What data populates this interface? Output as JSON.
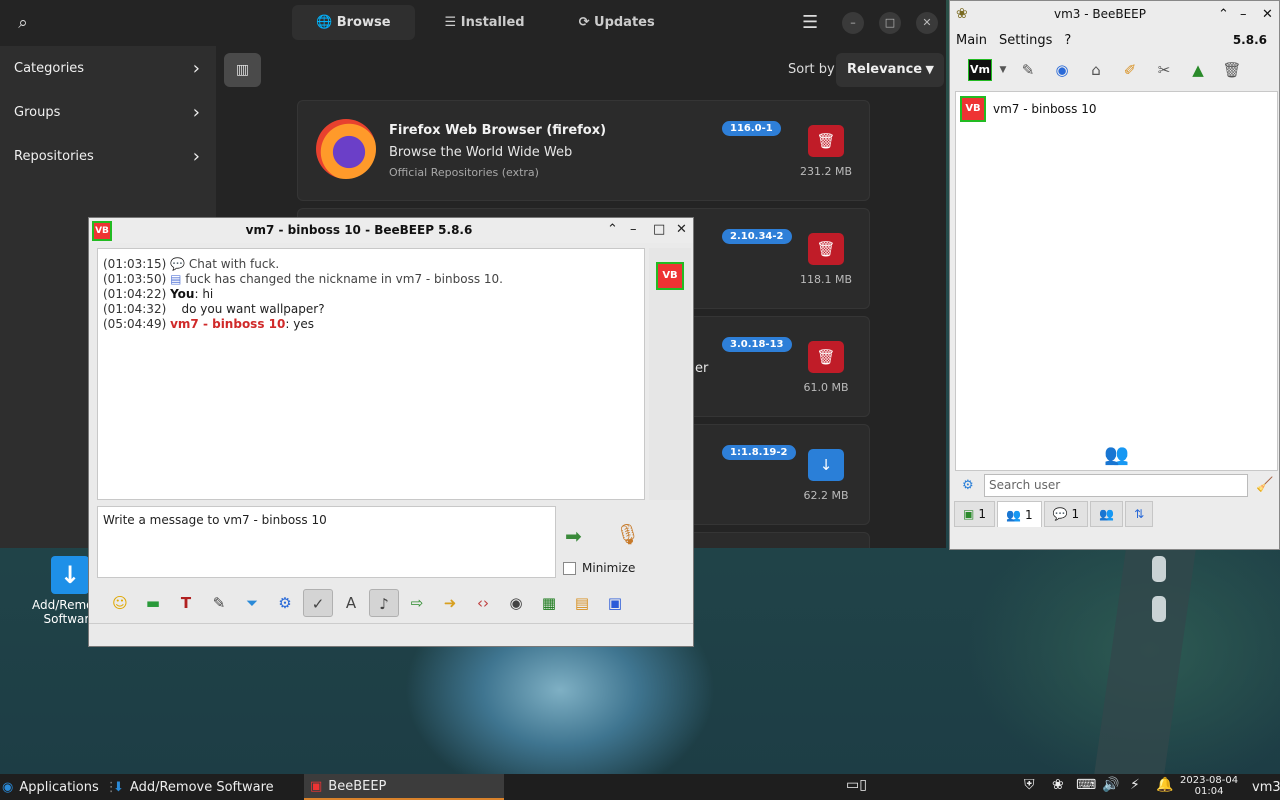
{
  "desktop": {
    "icon_label": "Add/Remove Software"
  },
  "software": {
    "tabs": [
      "Browse",
      "Installed",
      "Updates"
    ],
    "sidebar": [
      "Categories",
      "Groups",
      "Repositories"
    ],
    "sort_label": "Sort by",
    "sort_value": "Relevance",
    "packages": [
      {
        "title": "Firefox Web Browser (firefox)",
        "description": "Browse the World Wide Web",
        "repo": "Official Repositories (extra)",
        "version": "116.0-1",
        "size": "231.2 MB",
        "action": "remove"
      },
      {
        "title": "",
        "description": "",
        "repo": "",
        "version": "2.10.34-2",
        "size": "118.1 MB",
        "action": "remove"
      },
      {
        "title": "",
        "description": "er",
        "repo": "",
        "version": "3.0.18-13",
        "size": "61.0 MB",
        "action": "remove"
      },
      {
        "title": "",
        "description": "",
        "repo": "",
        "version": "1:1.8.19-2",
        "size": "62.2 MB",
        "action": "install"
      }
    ]
  },
  "chat": {
    "title": "vm7 - binboss 10 - BeeBEEP 5.8.6",
    "avatar": "VB",
    "messages": [
      {
        "time": "(01:03:15)",
        "sender": "",
        "text": "Chat with fuck.",
        "kind": "system"
      },
      {
        "time": "(01:03:50)",
        "sender": "",
        "text": "fuck has changed the nickname in vm7 - binboss 10.",
        "kind": "system"
      },
      {
        "time": "(01:04:22)",
        "sender": "You",
        "text": ": hi",
        "kind": "me"
      },
      {
        "time": "(01:04:32)",
        "sender": "",
        "text": "do you want wallpaper?",
        "kind": "cont"
      },
      {
        "time": "(05:04:49)",
        "sender": "vm7 - binboss 10",
        "text": ": yes",
        "kind": "peer"
      }
    ],
    "input_placeholder": "Write a message to vm7 - binboss 10",
    "minimize_label": "Minimize"
  },
  "bee": {
    "title": "vm3 - BeeBEEP",
    "menu": [
      "Main",
      "Settings",
      "?"
    ],
    "version": "5.8.6",
    "user": "vm7 - binboss 10",
    "search_placeholder": "Search user",
    "tab_counts": [
      "1",
      "1",
      "1"
    ]
  },
  "taskbar": {
    "applications": "Applications",
    "app1": "Add/Remove Software",
    "app2": "BeeBEEP",
    "date": "2023-08-04",
    "time": "01:04",
    "user": "vm3"
  }
}
